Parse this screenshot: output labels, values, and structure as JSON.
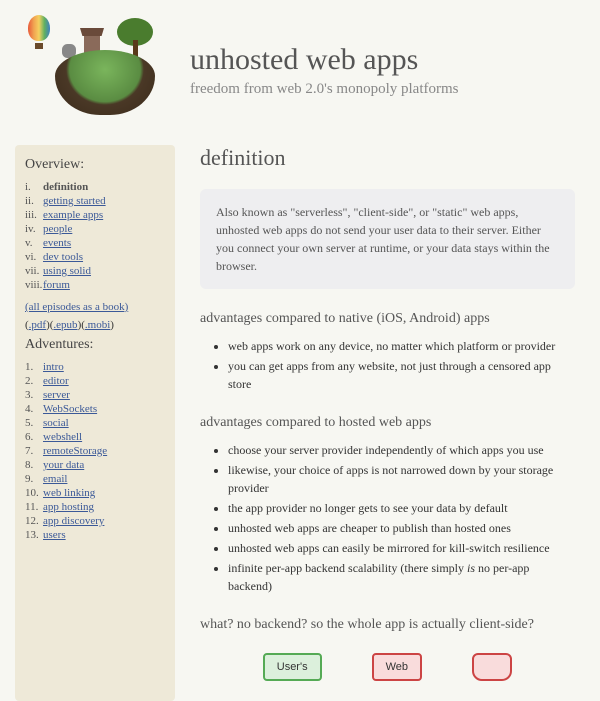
{
  "header": {
    "title": "unhosted web apps",
    "subtitle": "freedom from web 2.0's monopoly platforms"
  },
  "sidebar": {
    "overview_heading": "Overview:",
    "overview": [
      {
        "num": "i.",
        "label": "definition",
        "active": true,
        "link": false
      },
      {
        "num": "ii.",
        "label": "getting started",
        "link": true
      },
      {
        "num": "iii.",
        "label": "example apps",
        "link": true
      },
      {
        "num": "iv.",
        "label": "people",
        "link": true
      },
      {
        "num": "v.",
        "label": "events",
        "link": true
      },
      {
        "num": "vi.",
        "label": "dev tools",
        "link": true
      },
      {
        "num": "vii.",
        "label": "using solid",
        "link": true
      },
      {
        "num": "viii.",
        "label": "forum",
        "link": true
      }
    ],
    "book_link": "(all episodes as a book)",
    "formats_prefix": "(",
    "formats": [
      ".pdf",
      ".epub",
      ".mobi"
    ],
    "formats_sep": ")(",
    "formats_suffix": ")",
    "adventures_heading": "Adventures:",
    "adventures": [
      {
        "num": "1.",
        "label": "intro"
      },
      {
        "num": "2.",
        "label": "editor"
      },
      {
        "num": "3.",
        "label": "server"
      },
      {
        "num": "4.",
        "label": "WebSockets"
      },
      {
        "num": "5.",
        "label": "social"
      },
      {
        "num": "6.",
        "label": "webshell"
      },
      {
        "num": "7.",
        "label": "remoteStorage"
      },
      {
        "num": "8.",
        "label": "your data"
      },
      {
        "num": "9.",
        "label": "email"
      },
      {
        "num": "10.",
        "label": "web linking"
      },
      {
        "num": "11.",
        "label": "app hosting"
      },
      {
        "num": "12.",
        "label": "app discovery"
      },
      {
        "num": "13.",
        "label": "users"
      }
    ]
  },
  "main": {
    "h2": "definition",
    "callout": "Also known as \"serverless\", \"client-side\", or \"static\" web apps, unhosted web apps do not send your user data to their server. Either you connect your own server at runtime, or your data stays within the browser.",
    "adv_native_h": "advantages compared to native (iOS, Android) apps",
    "adv_native": [
      "web apps work on any device, no matter which platform or provider",
      "you can get apps from any website, not just through a censored app store"
    ],
    "adv_hosted_h": "advantages compared to hosted web apps",
    "adv_hosted": [
      "choose your server provider independently of which apps you use",
      "likewise, your choice of apps is not narrowed down by your storage provider",
      "the app provider no longer gets to see your data by default",
      "unhosted web apps are cheaper to publish than hosted ones",
      "unhosted web apps can easily be mirrored for kill-switch resilience",
      "infinite per-app backend scalability (there simply is no per-app backend)"
    ],
    "what_h": "what? no backend? so the whole app is actually client-side?",
    "diagram": {
      "box1": "User's",
      "box2": "Web"
    }
  }
}
